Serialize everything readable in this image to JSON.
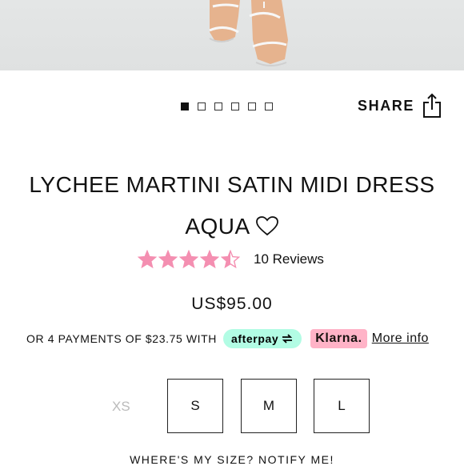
{
  "gallery": {
    "slide_count": 6,
    "active_index": 0
  },
  "share": {
    "label": "SHARE",
    "icon": "share-icon"
  },
  "product": {
    "title_line1": "LYCHEE MARTINI SATIN MIDI DRESS",
    "title_line2": "AQUA",
    "wishlist_icon": "heart-outline-icon",
    "rating": 4.5,
    "rating_max": 5,
    "reviews_label": "10 Reviews",
    "price": "US$95.00"
  },
  "payments": {
    "text": "OR 4 PAYMENTS OF $23.75 WITH",
    "afterpay_label": "afterpay",
    "klarna_label": "Klarna.",
    "more_info": "More info"
  },
  "sizes": [
    {
      "label": "XS",
      "available": false
    },
    {
      "label": "S",
      "available": true
    },
    {
      "label": "M",
      "available": true
    },
    {
      "label": "L",
      "available": true
    }
  ],
  "notify_text": "WHERE'S MY SIZE? NOTIFY ME!",
  "colors": {
    "star": "#f48fb1",
    "afterpay_bg": "#b2fce4",
    "klarna_bg": "#ffb3c7",
    "unavailable": "#bbbbbb"
  }
}
